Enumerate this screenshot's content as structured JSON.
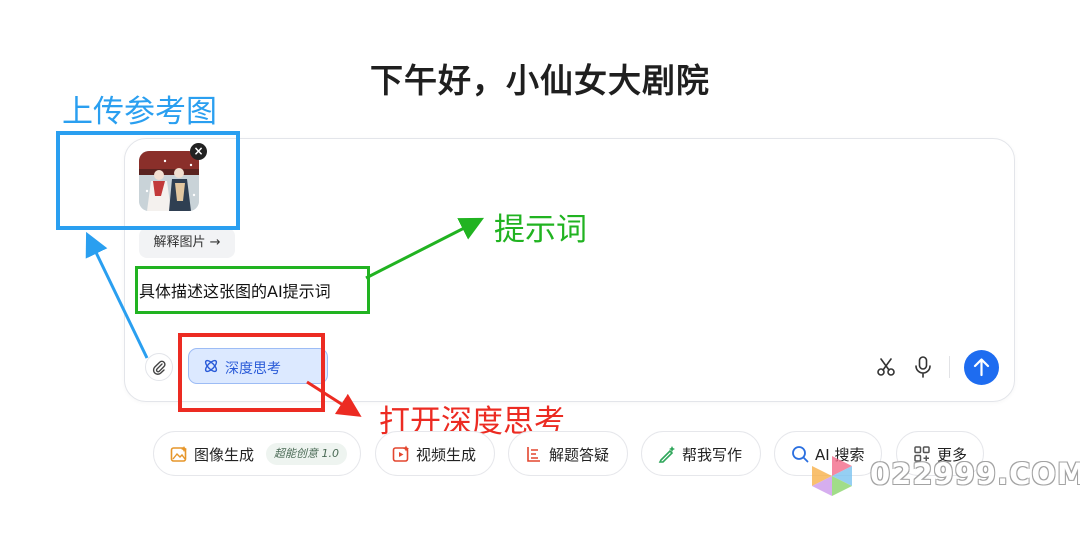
{
  "greeting": "下午好，小仙女大剧院",
  "composer": {
    "explain_image_label": "解释图片 →",
    "prompt_text": "具体描述这张图的AI提示词",
    "deep_think_label": "深度思考"
  },
  "annotations": {
    "upload": "上传参考图",
    "prompt": "提示词",
    "deep_think": "打开深度思考"
  },
  "chips": [
    {
      "label": "图像生成",
      "badge": "超能创意 1.0",
      "icon": "image-gen-icon"
    },
    {
      "label": "视频生成",
      "icon": "video-gen-icon"
    },
    {
      "label": "解题答疑",
      "icon": "solve-icon"
    },
    {
      "label": "帮我写作",
      "icon": "write-icon"
    },
    {
      "label": "AI 搜索",
      "icon": "ai-search-icon"
    },
    {
      "label": "更多",
      "icon": "more-grid-icon"
    }
  ],
  "watermark": "022999.COM",
  "colors": {
    "accent_blue": "#1e6cf0",
    "annotation_blue": "#2a9ff0",
    "annotation_green": "#21b321",
    "annotation_red": "#ec2b22"
  }
}
